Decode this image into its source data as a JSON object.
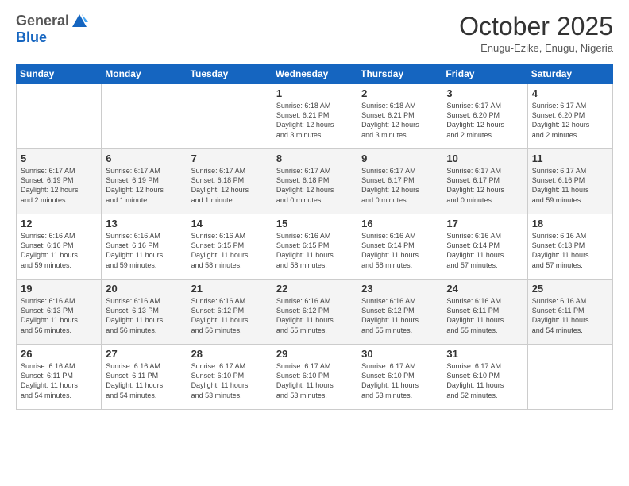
{
  "header": {
    "logo_general": "General",
    "logo_blue": "Blue",
    "month": "October 2025",
    "location": "Enugu-Ezike, Enugu, Nigeria"
  },
  "weekdays": [
    "Sunday",
    "Monday",
    "Tuesday",
    "Wednesday",
    "Thursday",
    "Friday",
    "Saturday"
  ],
  "weeks": [
    [
      {
        "day": "",
        "info": ""
      },
      {
        "day": "",
        "info": ""
      },
      {
        "day": "",
        "info": ""
      },
      {
        "day": "1",
        "info": "Sunrise: 6:18 AM\nSunset: 6:21 PM\nDaylight: 12 hours\nand 3 minutes."
      },
      {
        "day": "2",
        "info": "Sunrise: 6:18 AM\nSunset: 6:21 PM\nDaylight: 12 hours\nand 3 minutes."
      },
      {
        "day": "3",
        "info": "Sunrise: 6:17 AM\nSunset: 6:20 PM\nDaylight: 12 hours\nand 2 minutes."
      },
      {
        "day": "4",
        "info": "Sunrise: 6:17 AM\nSunset: 6:20 PM\nDaylight: 12 hours\nand 2 minutes."
      }
    ],
    [
      {
        "day": "5",
        "info": "Sunrise: 6:17 AM\nSunset: 6:19 PM\nDaylight: 12 hours\nand 2 minutes."
      },
      {
        "day": "6",
        "info": "Sunrise: 6:17 AM\nSunset: 6:19 PM\nDaylight: 12 hours\nand 1 minute."
      },
      {
        "day": "7",
        "info": "Sunrise: 6:17 AM\nSunset: 6:18 PM\nDaylight: 12 hours\nand 1 minute."
      },
      {
        "day": "8",
        "info": "Sunrise: 6:17 AM\nSunset: 6:18 PM\nDaylight: 12 hours\nand 0 minutes."
      },
      {
        "day": "9",
        "info": "Sunrise: 6:17 AM\nSunset: 6:17 PM\nDaylight: 12 hours\nand 0 minutes."
      },
      {
        "day": "10",
        "info": "Sunrise: 6:17 AM\nSunset: 6:17 PM\nDaylight: 12 hours\nand 0 minutes."
      },
      {
        "day": "11",
        "info": "Sunrise: 6:17 AM\nSunset: 6:16 PM\nDaylight: 11 hours\nand 59 minutes."
      }
    ],
    [
      {
        "day": "12",
        "info": "Sunrise: 6:16 AM\nSunset: 6:16 PM\nDaylight: 11 hours\nand 59 minutes."
      },
      {
        "day": "13",
        "info": "Sunrise: 6:16 AM\nSunset: 6:16 PM\nDaylight: 11 hours\nand 59 minutes."
      },
      {
        "day": "14",
        "info": "Sunrise: 6:16 AM\nSunset: 6:15 PM\nDaylight: 11 hours\nand 58 minutes."
      },
      {
        "day": "15",
        "info": "Sunrise: 6:16 AM\nSunset: 6:15 PM\nDaylight: 11 hours\nand 58 minutes."
      },
      {
        "day": "16",
        "info": "Sunrise: 6:16 AM\nSunset: 6:14 PM\nDaylight: 11 hours\nand 58 minutes."
      },
      {
        "day": "17",
        "info": "Sunrise: 6:16 AM\nSunset: 6:14 PM\nDaylight: 11 hours\nand 57 minutes."
      },
      {
        "day": "18",
        "info": "Sunrise: 6:16 AM\nSunset: 6:13 PM\nDaylight: 11 hours\nand 57 minutes."
      }
    ],
    [
      {
        "day": "19",
        "info": "Sunrise: 6:16 AM\nSunset: 6:13 PM\nDaylight: 11 hours\nand 56 minutes."
      },
      {
        "day": "20",
        "info": "Sunrise: 6:16 AM\nSunset: 6:13 PM\nDaylight: 11 hours\nand 56 minutes."
      },
      {
        "day": "21",
        "info": "Sunrise: 6:16 AM\nSunset: 6:12 PM\nDaylight: 11 hours\nand 56 minutes."
      },
      {
        "day": "22",
        "info": "Sunrise: 6:16 AM\nSunset: 6:12 PM\nDaylight: 11 hours\nand 55 minutes."
      },
      {
        "day": "23",
        "info": "Sunrise: 6:16 AM\nSunset: 6:12 PM\nDaylight: 11 hours\nand 55 minutes."
      },
      {
        "day": "24",
        "info": "Sunrise: 6:16 AM\nSunset: 6:11 PM\nDaylight: 11 hours\nand 55 minutes."
      },
      {
        "day": "25",
        "info": "Sunrise: 6:16 AM\nSunset: 6:11 PM\nDaylight: 11 hours\nand 54 minutes."
      }
    ],
    [
      {
        "day": "26",
        "info": "Sunrise: 6:16 AM\nSunset: 6:11 PM\nDaylight: 11 hours\nand 54 minutes."
      },
      {
        "day": "27",
        "info": "Sunrise: 6:16 AM\nSunset: 6:11 PM\nDaylight: 11 hours\nand 54 minutes."
      },
      {
        "day": "28",
        "info": "Sunrise: 6:17 AM\nSunset: 6:10 PM\nDaylight: 11 hours\nand 53 minutes."
      },
      {
        "day": "29",
        "info": "Sunrise: 6:17 AM\nSunset: 6:10 PM\nDaylight: 11 hours\nand 53 minutes."
      },
      {
        "day": "30",
        "info": "Sunrise: 6:17 AM\nSunset: 6:10 PM\nDaylight: 11 hours\nand 53 minutes."
      },
      {
        "day": "31",
        "info": "Sunrise: 6:17 AM\nSunset: 6:10 PM\nDaylight: 11 hours\nand 52 minutes."
      },
      {
        "day": "",
        "info": ""
      }
    ]
  ]
}
